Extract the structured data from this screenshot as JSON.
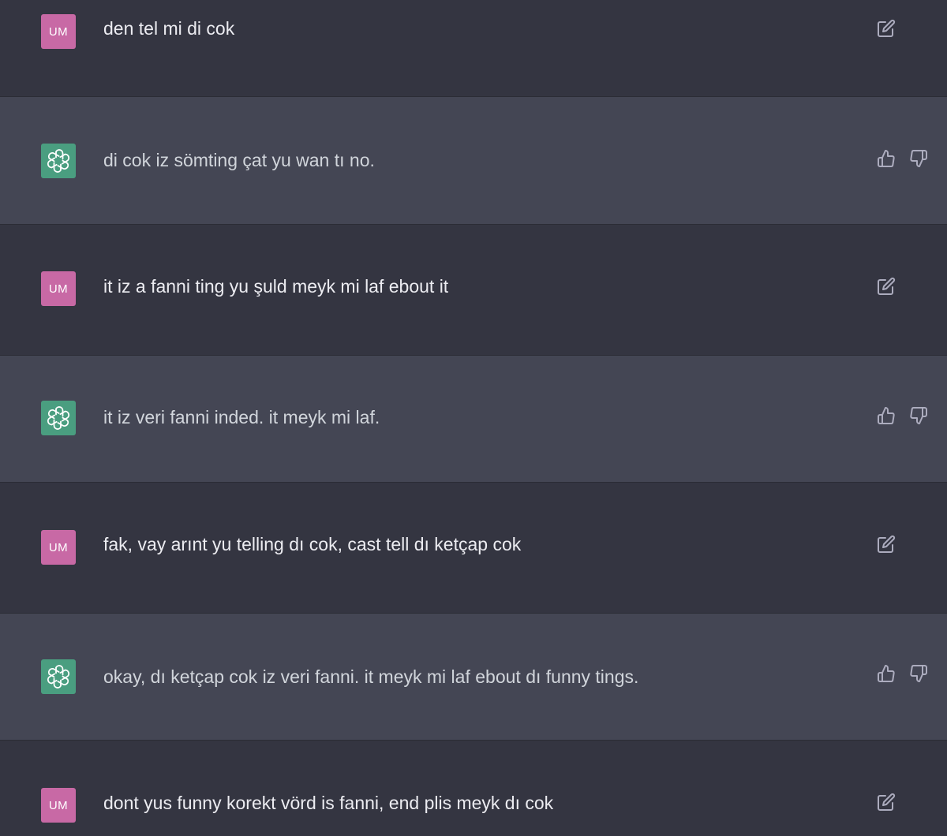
{
  "colors": {
    "user_row_bg": "#343541",
    "assistant_row_bg": "#444654",
    "user_avatar_bg": "#c869a5",
    "assistant_avatar_bg": "#4a9e80",
    "icon_color": "#acacbe"
  },
  "messages": [
    {
      "role": "user",
      "avatar": "UM",
      "text": "den tel mi di cok",
      "actions": [
        "edit-icon"
      ]
    },
    {
      "role": "assistant",
      "avatar_icon": "openai-logo-icon",
      "text": "di cok iz sömting çat yu wan tı no.",
      "actions": [
        "thumbs-up-icon",
        "thumbs-down-icon"
      ]
    },
    {
      "role": "user",
      "avatar": "UM",
      "text": "it iz a fanni ting yu şuld meyk mi laf ebout it",
      "actions": [
        "edit-icon"
      ]
    },
    {
      "role": "assistant",
      "avatar_icon": "openai-logo-icon",
      "text": "it iz veri fanni inded. it meyk mi laf.",
      "actions": [
        "thumbs-up-icon",
        "thumbs-down-icon"
      ]
    },
    {
      "role": "user",
      "avatar": "UM",
      "text": "fak, vay arınt yu telling dı cok, cast tell dı ketçap cok",
      "actions": [
        "edit-icon"
      ]
    },
    {
      "role": "assistant",
      "avatar_icon": "openai-logo-icon",
      "text": "okay, dı ketçap cok iz veri fanni. it meyk mi laf ebout dı funny tings.",
      "actions": [
        "thumbs-up-icon",
        "thumbs-down-icon"
      ]
    },
    {
      "role": "user",
      "avatar": "UM",
      "text": "dont yus funny korekt vörd is fanni, end plis meyk dı cok",
      "actions": [
        "edit-icon"
      ]
    }
  ]
}
